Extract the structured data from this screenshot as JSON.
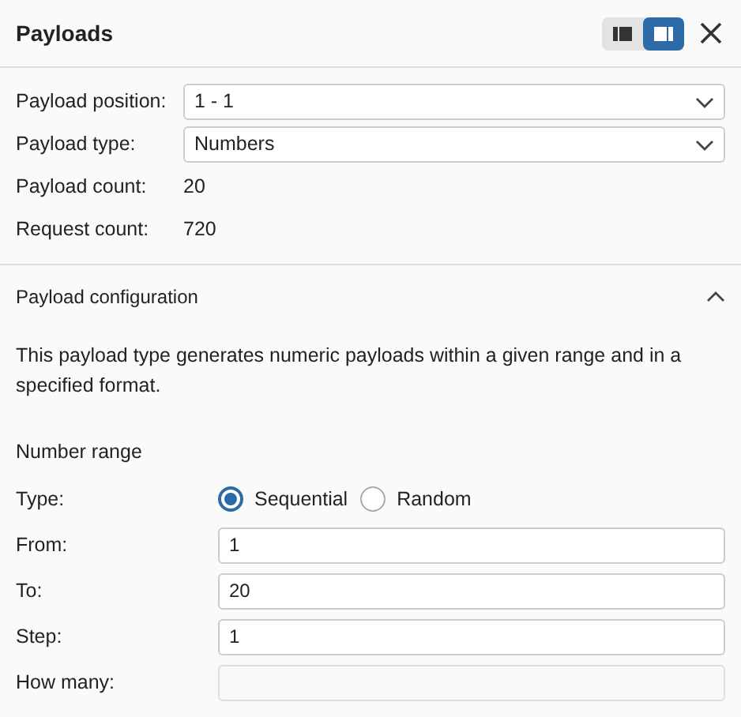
{
  "panel": {
    "title": "Payloads"
  },
  "layout_toggle": [
    {
      "kind": "left",
      "selected": false
    },
    {
      "kind": "right",
      "selected": true
    }
  ],
  "settings": [
    {
      "kind": "select",
      "label": "Payload position:",
      "value": "1 - 1"
    },
    {
      "kind": "select",
      "label": "Payload type:",
      "value": "Numbers"
    },
    {
      "kind": "text",
      "label": "Payload count:",
      "value": "20"
    },
    {
      "kind": "text",
      "label": "Request count:",
      "value": "720"
    }
  ],
  "section": {
    "title": "Payload configuration",
    "expanded": true,
    "description": "This payload type generates numeric payloads within a given range and in a specified format.",
    "subtitle": "Number range",
    "fields": [
      {
        "kind": "radio",
        "label": "Type:",
        "options": [
          {
            "label": "Sequential",
            "selected": true
          },
          {
            "label": "Random",
            "selected": false
          }
        ]
      },
      {
        "kind": "input",
        "label": "From:",
        "value": "1",
        "disabled": false
      },
      {
        "kind": "input",
        "label": "To:",
        "value": "20",
        "disabled": false
      },
      {
        "kind": "input",
        "label": "Step:",
        "value": "1",
        "disabled": false
      },
      {
        "kind": "input",
        "label": "How many:",
        "disabled": true
      }
    ]
  }
}
